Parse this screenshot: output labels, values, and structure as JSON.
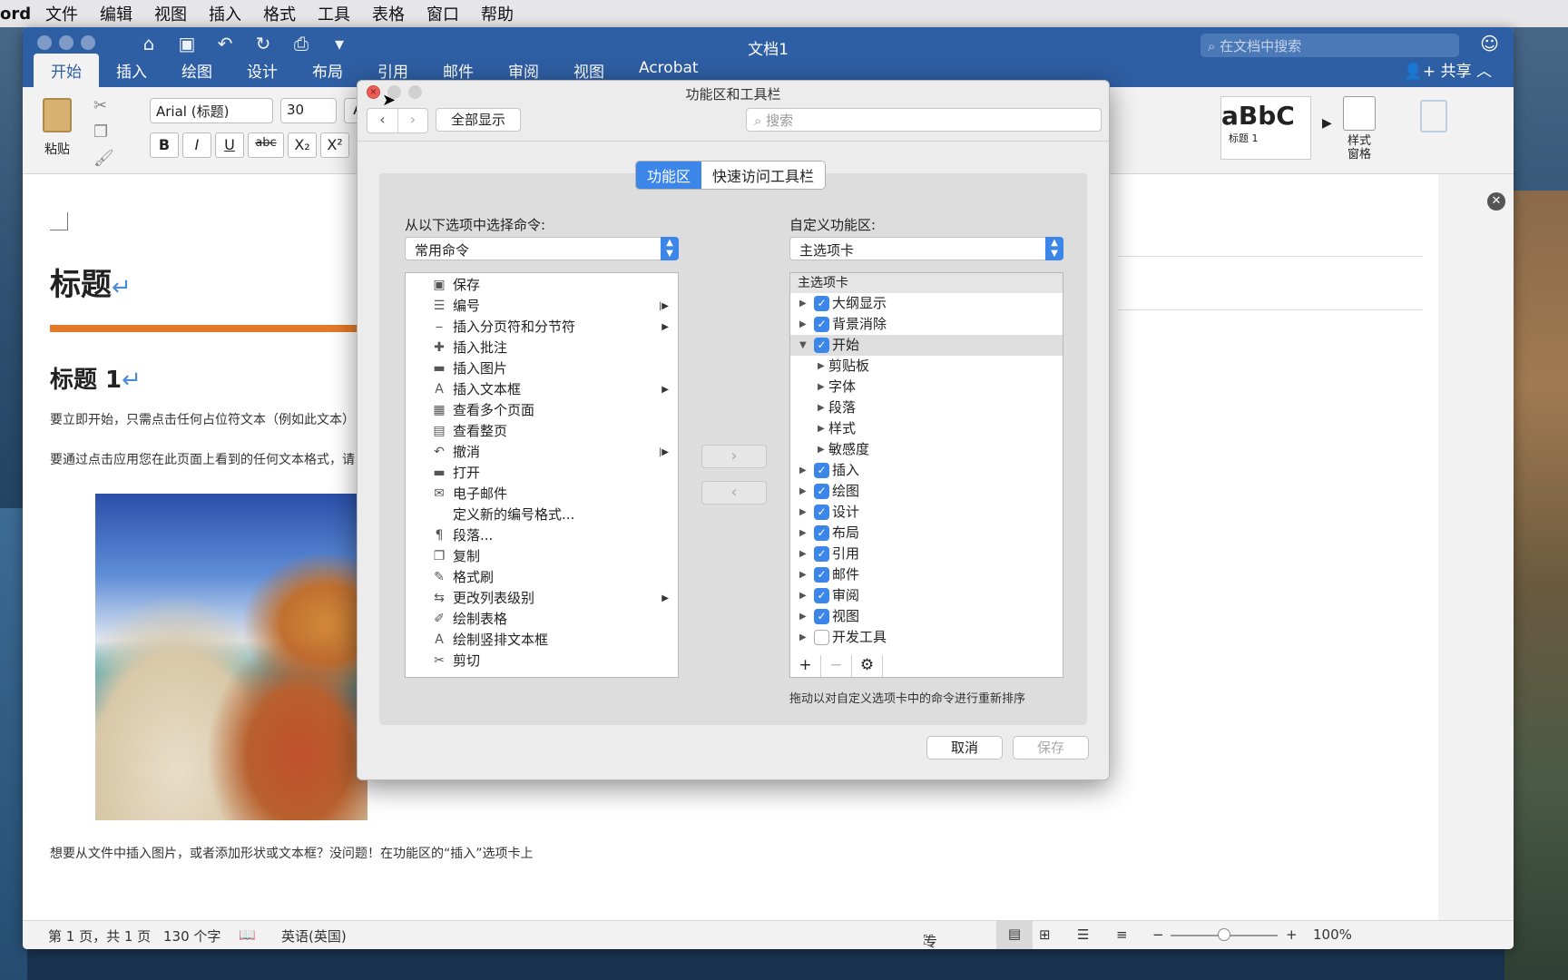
{
  "menubar": {
    "app": "ord",
    "items": [
      "文件",
      "编辑",
      "视图",
      "插入",
      "格式",
      "工具",
      "表格",
      "窗口",
      "帮助"
    ]
  },
  "window": {
    "title": "文档1",
    "search_placeholder": "在文档中搜索",
    "tabs": [
      "开始",
      "插入",
      "绘图",
      "设计",
      "布局",
      "引用",
      "邮件",
      "审阅",
      "视图",
      "Acrobat"
    ],
    "share": "共享"
  },
  "ribbon": {
    "paste": "粘贴",
    "font_name": "Arial (标题)",
    "font_size": "30",
    "bold": "B",
    "italic": "I",
    "underline": "U",
    "strike": "abc",
    "subscript": "X₂",
    "superscript": "X²",
    "style_preview": "aBbC",
    "style_name": "标题 1",
    "style_pane": "样式\n窗格"
  },
  "document": {
    "title": "标题",
    "heading1": "标题 1",
    "para1": "要立即开始，只需点击任何占位符文本（例如此文本）",
    "para2": "要通过点击应用您在此页面上看到的任何文本格式，请",
    "para3": "想要从文件中插入图片，或者添加形状或文本框？没问题！在功能区的“插入”选项卡上"
  },
  "status": {
    "page": "第 1 页，共 1 页",
    "words": "130 个字",
    "language": "英语(英国)",
    "focus": "专注",
    "zoom": "100%",
    "zoom_level_pct": 50
  },
  "dialog": {
    "title": "功能区和工具栏",
    "show_all": "全部显示",
    "search_placeholder": "搜索",
    "seg_ribbon": "功能区",
    "seg_qat": "快速访问工具栏",
    "left_label": "从以下选项中选择命令:",
    "left_select": "常用命令",
    "right_label": "自定义功能区:",
    "right_select": "主选项卡",
    "commands": [
      {
        "icon": "save-icon",
        "glyph": "▣",
        "label": "保存",
        "sub": ""
      },
      {
        "icon": "numbering-icon",
        "glyph": "☰",
        "label": "编号",
        "sub": "|▶"
      },
      {
        "icon": "page-break-icon",
        "glyph": "⎯",
        "label": "插入分页符和分节符",
        "sub": "▶"
      },
      {
        "icon": "comment-icon",
        "glyph": "✚",
        "label": "插入批注",
        "sub": ""
      },
      {
        "icon": "picture-folder-icon",
        "glyph": "▬",
        "label": "插入图片",
        "sub": ""
      },
      {
        "icon": "textbox-icon",
        "glyph": "A",
        "label": "插入文本框",
        "sub": "▶"
      },
      {
        "icon": "multipage-icon",
        "glyph": "▦",
        "label": "查看多个页面",
        "sub": ""
      },
      {
        "icon": "fullpage-icon",
        "glyph": "▤",
        "label": "查看整页",
        "sub": ""
      },
      {
        "icon": "undo-icon",
        "glyph": "↶",
        "label": "撤消",
        "sub": "|▶"
      },
      {
        "icon": "open-folder-icon",
        "glyph": "▬",
        "label": "打开",
        "sub": ""
      },
      {
        "icon": "email-icon",
        "glyph": "✉",
        "label": "电子邮件",
        "sub": ""
      },
      {
        "icon": "none",
        "glyph": "",
        "label": "定义新的编号格式...",
        "sub": ""
      },
      {
        "icon": "paragraph-icon",
        "glyph": "¶",
        "label": "段落...",
        "sub": ""
      },
      {
        "icon": "copy-icon",
        "glyph": "❐",
        "label": "复制",
        "sub": ""
      },
      {
        "icon": "format-painter-icon",
        "glyph": "✎",
        "label": "格式刷",
        "sub": ""
      },
      {
        "icon": "list-level-icon",
        "glyph": "⇆",
        "label": "更改列表级别",
        "sub": "▶"
      },
      {
        "icon": "draw-table-icon",
        "glyph": "✐",
        "label": "绘制表格",
        "sub": ""
      },
      {
        "icon": "vertical-textbox-icon",
        "glyph": "A",
        "label": "绘制竖排文本框",
        "sub": ""
      },
      {
        "icon": "scissors-icon",
        "glyph": "✂",
        "label": "剪切",
        "sub": ""
      },
      {
        "icon": "partial-icon",
        "glyph": "",
        "label": "",
        "sub": ""
      }
    ],
    "tree_header": "主选项卡",
    "tree": [
      {
        "label": "大纲显示",
        "level": 0,
        "checked": true,
        "expanded": false
      },
      {
        "label": "背景消除",
        "level": 0,
        "checked": true,
        "expanded": false
      },
      {
        "label": "开始",
        "level": 0,
        "checked": true,
        "expanded": true
      },
      {
        "label": "剪贴板",
        "level": 1,
        "checked": null,
        "expanded": false
      },
      {
        "label": "字体",
        "level": 1,
        "checked": null,
        "expanded": false
      },
      {
        "label": "段落",
        "level": 1,
        "checked": null,
        "expanded": false
      },
      {
        "label": "样式",
        "level": 1,
        "checked": null,
        "expanded": false
      },
      {
        "label": "敏感度",
        "level": 1,
        "checked": null,
        "expanded": false
      },
      {
        "label": "插入",
        "level": 0,
        "checked": true,
        "expanded": false
      },
      {
        "label": "绘图",
        "level": 0,
        "checked": true,
        "expanded": false
      },
      {
        "label": "设计",
        "level": 0,
        "checked": true,
        "expanded": false
      },
      {
        "label": "布局",
        "level": 0,
        "checked": true,
        "expanded": false
      },
      {
        "label": "引用",
        "level": 0,
        "checked": true,
        "expanded": false
      },
      {
        "label": "邮件",
        "level": 0,
        "checked": true,
        "expanded": false
      },
      {
        "label": "审阅",
        "level": 0,
        "checked": true,
        "expanded": false
      },
      {
        "label": "视图",
        "level": 0,
        "checked": true,
        "expanded": false
      },
      {
        "label": "开发工具",
        "level": 0,
        "checked": false,
        "expanded": false
      }
    ],
    "hint": "拖动以对自定义选项卡中的命令进行重新排序",
    "cancel": "取消",
    "save": "保存"
  },
  "colors": {
    "accent": "#3b86e8",
    "titlebar": "#2e5ea3",
    "orange": "#e37a2a"
  }
}
